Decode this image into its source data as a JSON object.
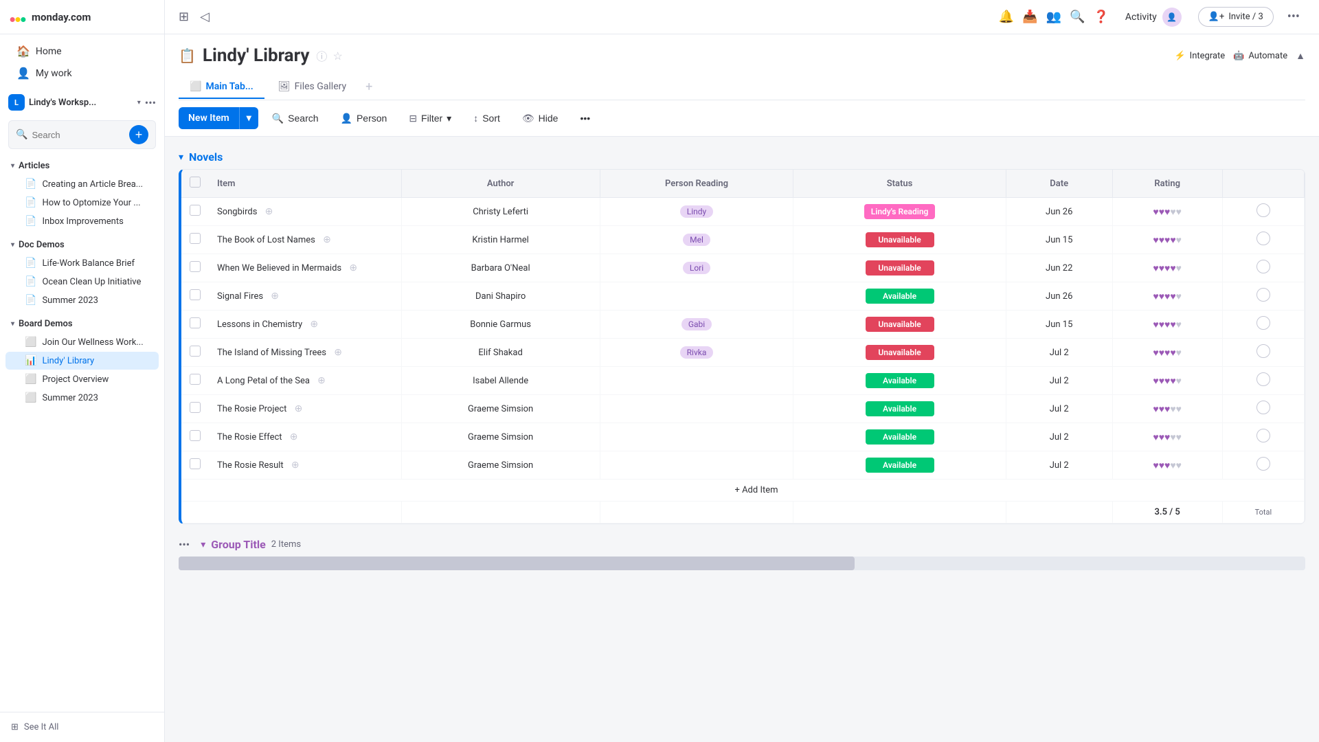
{
  "app": {
    "name": "monday.com"
  },
  "topbar": {
    "activity_label": "Activity",
    "invite_label": "Invite / 3"
  },
  "board": {
    "icon": "📋",
    "title": "Lindy' Library",
    "tabs": [
      "Main Tab...",
      "Files Gallery"
    ],
    "active_tab": "Main Tab...",
    "integrate_label": "Integrate",
    "automate_label": "Automate"
  },
  "toolbar": {
    "new_item": "New Item",
    "search": "Search",
    "person": "Person",
    "filter": "Filter",
    "sort": "Sort",
    "hide": "Hide"
  },
  "sidebar": {
    "logo_text": "monday.com",
    "nav": [
      {
        "icon": "🏠",
        "label": "Home"
      },
      {
        "icon": "👤",
        "label": "My work"
      }
    ],
    "workspace_name": "Lindy's Worksp...",
    "workspace_initial": "L",
    "search_placeholder": "Search",
    "sections": [
      {
        "title": "Articles",
        "items": [
          {
            "icon": "📄",
            "label": "Creating an Article Brea...",
            "active": false
          },
          {
            "icon": "📄",
            "label": "How to Optomize Your ...",
            "active": false
          },
          {
            "icon": "📄",
            "label": "Inbox Improvements",
            "active": false
          }
        ]
      },
      {
        "title": "Doc Demos",
        "items": [
          {
            "icon": "📄",
            "label": "Life-Work Balance Brief",
            "active": false
          },
          {
            "icon": "📄",
            "label": "Ocean Clean Up Initiative",
            "active": false
          },
          {
            "icon": "📄",
            "label": "Summer 2023",
            "active": false
          }
        ]
      },
      {
        "title": "Board Demos",
        "items": [
          {
            "icon": "⬜",
            "label": "Join Our Wellness Work...",
            "active": false
          },
          {
            "icon": "📊",
            "label": "Lindy' Library",
            "active": true
          },
          {
            "icon": "⬜",
            "label": "Project Overview",
            "active": false
          },
          {
            "icon": "⬜",
            "label": "Summer 2023",
            "active": false
          }
        ]
      }
    ],
    "see_all": "See It All"
  },
  "novels": {
    "group_title": "Novels",
    "columns": [
      "Item",
      "Author",
      "Person Reading",
      "Status",
      "Date",
      "Rating"
    ],
    "rows": [
      {
        "name": "Songbirds",
        "author": "Christy Leferti",
        "person": "Lindy",
        "status": "Lindy's Reading",
        "status_type": "pink",
        "date": "Jun 26",
        "rating": 3
      },
      {
        "name": "The Book of Lost Names",
        "author": "Kristin Harmel",
        "person": "Mel",
        "status": "Unavailable",
        "status_type": "red",
        "date": "Jun 15",
        "rating": 4
      },
      {
        "name": "When We Believed in Mermaids",
        "author": "Barbara O'Neal",
        "person": "Lori",
        "status": "Unavailable",
        "status_type": "red",
        "date": "Jun 22",
        "rating": 4
      },
      {
        "name": "Signal Fires",
        "author": "Dani Shapiro",
        "person": "",
        "status": "Available",
        "status_type": "green",
        "date": "Jun 26",
        "rating": 4
      },
      {
        "name": "Lessons in Chemistry",
        "author": "Bonnie Garmus",
        "person": "Gabi",
        "status": "Unavailable",
        "status_type": "red",
        "date": "Jun 15",
        "rating": 4
      },
      {
        "name": "The Island of Missing Trees",
        "author": "Elif Shakad",
        "person": "Rivka",
        "status": "Unavailable",
        "status_type": "red",
        "date": "Jul 2",
        "rating": 4
      },
      {
        "name": "A Long Petal of the Sea",
        "author": "Isabel Allende",
        "person": "",
        "status": "Available",
        "status_type": "green",
        "date": "Jul 2",
        "rating": 4
      },
      {
        "name": "The Rosie Project",
        "author": "Graeme Simsion",
        "person": "",
        "status": "Available",
        "status_type": "green",
        "date": "Jul 2",
        "rating": 3
      },
      {
        "name": "The Rosie Effect",
        "author": "Graeme Simsion",
        "person": "",
        "status": "Available",
        "status_type": "green",
        "date": "Jul 2",
        "rating": 3
      },
      {
        "name": "The Rosie Result",
        "author": "Graeme Simsion",
        "person": "",
        "status": "Available",
        "status_type": "green",
        "date": "Jul 2",
        "rating": 3
      }
    ],
    "add_item": "+ Add Item",
    "avg_rating": "3.5 / 5",
    "total_label": "Total"
  },
  "group2": {
    "title": "Group Title",
    "count": "2 Items"
  }
}
